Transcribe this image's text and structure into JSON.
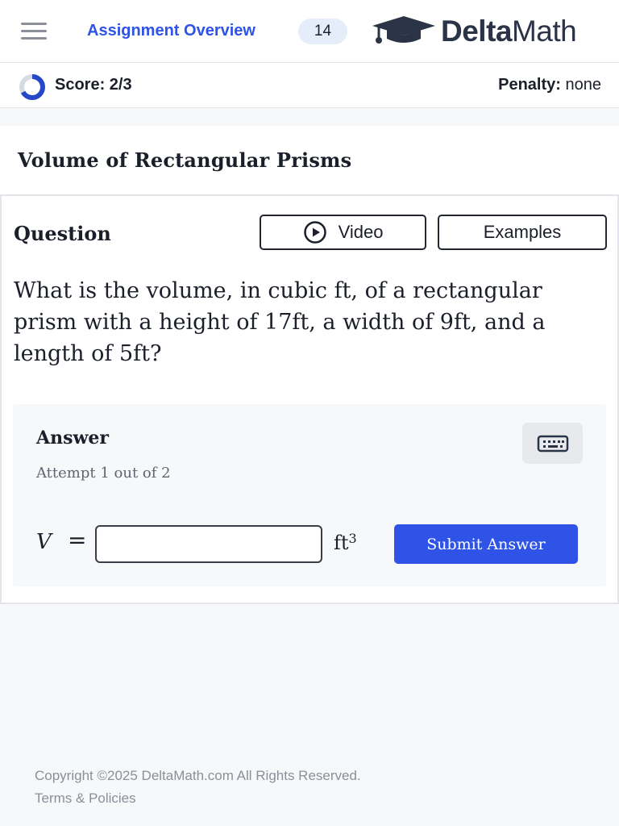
{
  "header": {
    "menu_icon": "hamburger-icon",
    "assignment_link": "Assignment Overview",
    "assignment_count": "14",
    "logo_bold": "Delta",
    "logo_light": "Math",
    "logo_icon": "graduation-cap-icon"
  },
  "scorebar": {
    "score_label": "Score: 2/3",
    "score_fraction": 0.6667,
    "penalty_label": "Penalty:",
    "penalty_value": "none"
  },
  "problem": {
    "title": "Volume of Rectangular Prisms",
    "question_heading": "Question",
    "video_button": "Video",
    "examples_button": "Examples",
    "question_text": "What is the volume, in cubic ft, of a rectangular prism with a height of 17ft, a width of 9ft, and a length of 5ft?"
  },
  "answer": {
    "heading": "Answer",
    "attempt_text": "Attempt 1 out of 2",
    "keyboard_icon": "keyboard-icon",
    "variable": "V",
    "equals": "=",
    "input_value": "",
    "unit": "ft",
    "unit_exponent": "3",
    "submit_button": "Submit Answer"
  },
  "footer": {
    "copyright": "Copyright ©2025 DeltaMath.com All Rights Reserved.",
    "terms_link": "Terms & Policies"
  },
  "colors": {
    "accent": "#2e53e6",
    "badge_bg": "#e4edf9",
    "logo_dark": "#2b3446"
  }
}
